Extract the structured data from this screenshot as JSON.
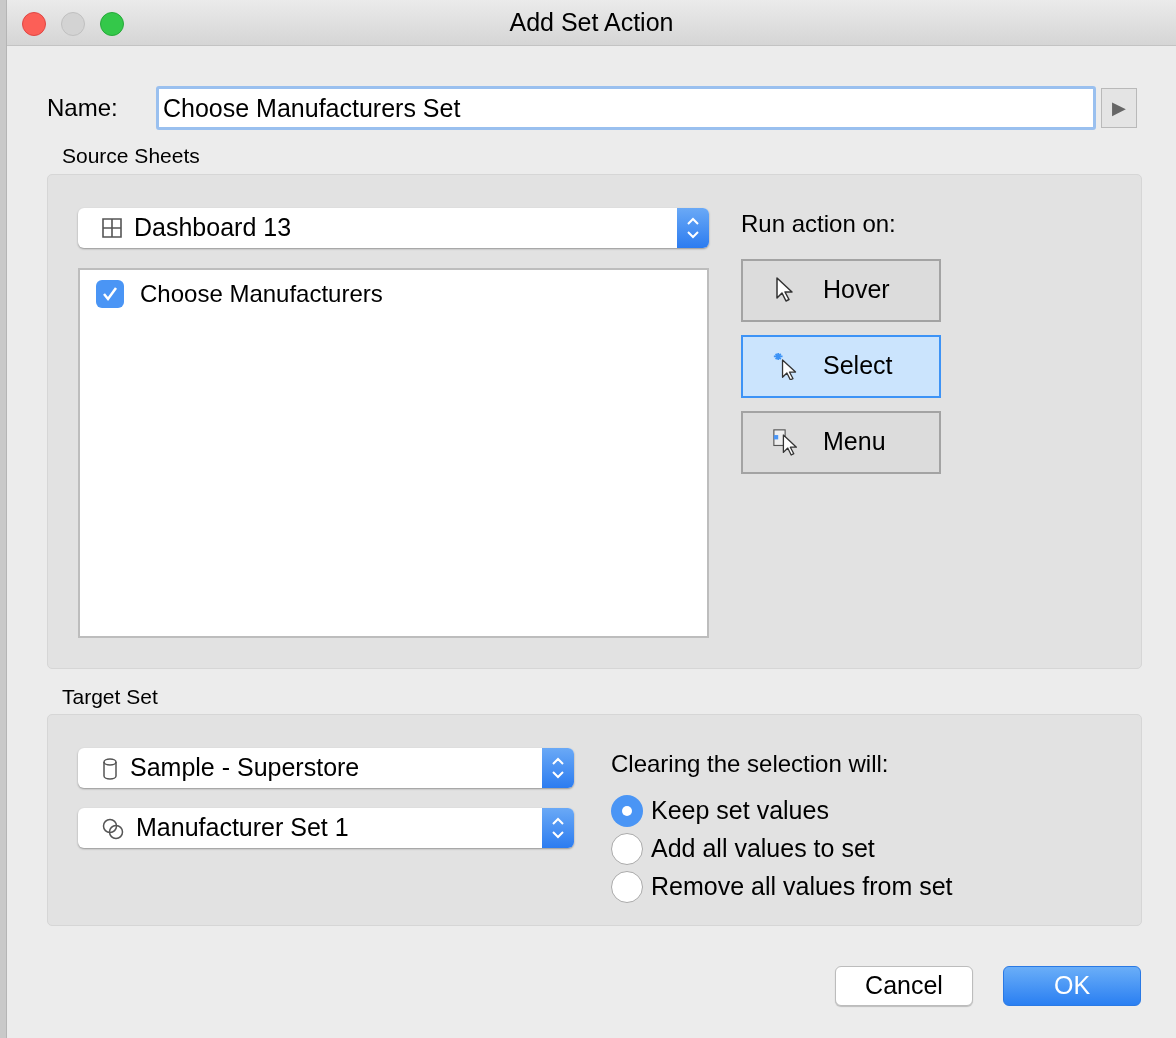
{
  "window": {
    "title": "Add Set Action"
  },
  "name_field": {
    "label": "Name:",
    "value": "Choose Manufacturers Set",
    "menu_button": "▶"
  },
  "source_sheets": {
    "label": "Source Sheets",
    "dropdown": {
      "value": "Dashboard 13"
    },
    "sheets": [
      {
        "label": "Choose Manufacturers",
        "checked": true
      }
    ],
    "run_action_label": "Run action on:",
    "triggers": [
      {
        "kind": "hover",
        "label": "Hover",
        "selected": false
      },
      {
        "kind": "select",
        "label": "Select",
        "selected": true
      },
      {
        "kind": "menu",
        "label": "Menu",
        "selected": false
      }
    ]
  },
  "target_set": {
    "label": "Target Set",
    "data_source": {
      "value": "Sample - Superstore"
    },
    "set": {
      "value": "Manufacturer Set 1"
    },
    "clearing_label": "Clearing the selection will:",
    "options": [
      {
        "label": "Keep set values",
        "selected": true
      },
      {
        "label": "Add all values to set",
        "selected": false
      },
      {
        "label": "Remove all values from set",
        "selected": false
      }
    ]
  },
  "buttons": [
    {
      "kind": "cancel",
      "label": "Cancel"
    },
    {
      "kind": "ok",
      "label": "OK"
    }
  ]
}
